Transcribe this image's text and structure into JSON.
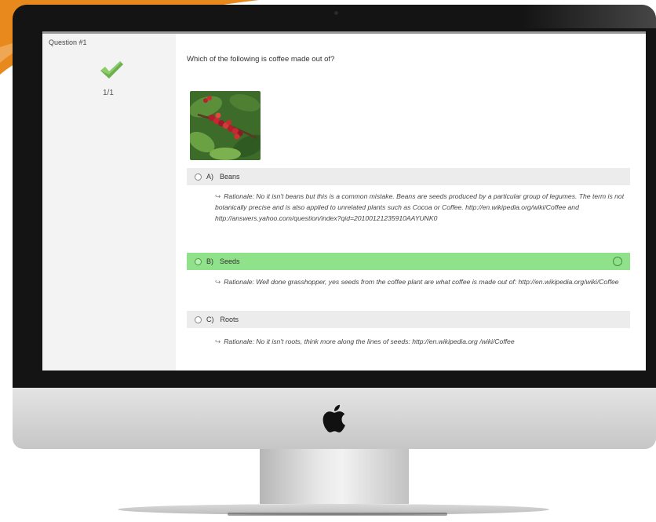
{
  "quiz": {
    "question_label": "Question #1",
    "score": "1/1",
    "question_text": "Which of the following is coffee made out of?",
    "options": [
      {
        "letter": "A)",
        "label": "Beans",
        "correct": false,
        "rationale": "Rationale: No it isn't beans but this is a common mistake. Beans are seeds produced by a particular group of legumes. The term is not botanically precise and is also applied to unrelated plants such as Cocoa or Coffee. http://en.wikipedia.org/wiki/Coffee and http://answers.yahoo.com/question/index?qid=20100121235910AAYUNK0"
      },
      {
        "letter": "B)",
        "label": "Seeds",
        "correct": true,
        "rationale": "Rationale: Well done grasshopper, yes seeds from the coffee plant are what coffee is made out of: http://en.wikipedia.org/wiki/Coffee"
      },
      {
        "letter": "C)",
        "label": "Roots",
        "correct": false,
        "rationale": "Rationale: No it isn't roots, think more along the lines of seeds: http://en.wikipedia.org /wiki/Coffee"
      }
    ]
  },
  "colors": {
    "correct_highlight": "#8fe28a",
    "option_background": "#ececec",
    "check_green": "#6ab04c",
    "accent_orange": "#e8891e"
  },
  "icons": {
    "check": "checkmark-icon",
    "arrow": "reply-arrow-icon",
    "apple": "apple-logo-icon"
  }
}
